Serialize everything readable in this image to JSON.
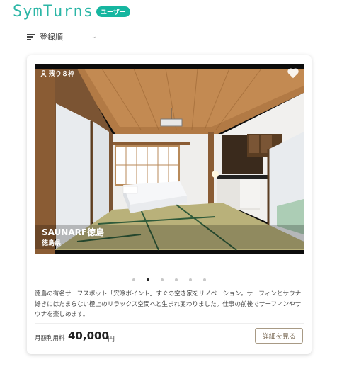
{
  "app": {
    "logo": "SymTurns",
    "badge": "ユーザー"
  },
  "sort": {
    "label": "登録順"
  },
  "listing": {
    "slots_label": "残り８枠",
    "name": "SAUNARF徳島",
    "location": "徳島県",
    "description": "徳島の有名サーフスポット「宍喰ポイント」すぐの空き家をリノベーション。サーフィンとサウナ好きにはたまらない極上のリラックス空間へと生まれ変わりました。仕事の前後でサーフィンやサウナを楽しめます。",
    "price_label": "月額利用料",
    "price_value": "40,000",
    "price_unit": "円",
    "detail_button": "詳細を見る",
    "carousel": {
      "count": 6,
      "active": 1
    }
  },
  "colors": {
    "brand": "#2bb6a6",
    "badge": "#16b6a0",
    "button_border": "#a89a85"
  }
}
